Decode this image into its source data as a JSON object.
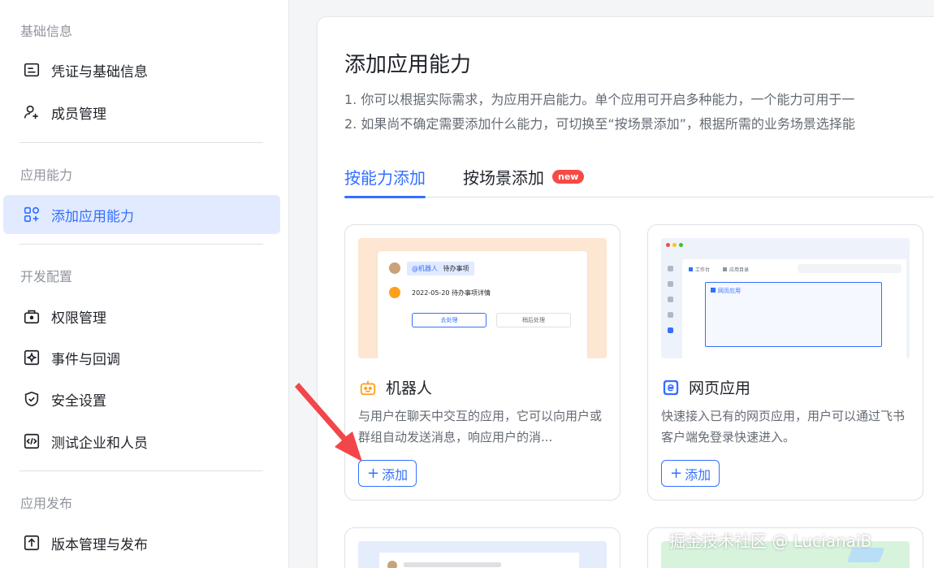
{
  "sidebar": {
    "sections": [
      {
        "title": "基础信息"
      },
      {
        "title": "应用能力"
      },
      {
        "title": "开发配置"
      },
      {
        "title": "应用发布"
      }
    ],
    "items": [
      {
        "label": "凭证与基础信息",
        "icon": "credential-icon"
      },
      {
        "label": "成员管理",
        "icon": "member-add-icon"
      },
      {
        "label": "添加应用能力",
        "icon": "grid-add-icon",
        "active": true
      },
      {
        "label": "权限管理",
        "icon": "permission-lock-icon"
      },
      {
        "label": "事件与回调",
        "icon": "event-icon"
      },
      {
        "label": "安全设置",
        "icon": "shield-check-icon"
      },
      {
        "label": "测试企业和人员",
        "icon": "test-code-icon"
      },
      {
        "label": "版本管理与发布",
        "icon": "upload-icon"
      }
    ]
  },
  "main": {
    "title": "添加应用能力",
    "desc1": "1. 你可以根据实际需求，为应用开启能力。单个应用可开启多种能力，一个能力可用于一",
    "desc2": "2. 如果尚不确定需要添加什么能力，可切换至“按场景添加”，根据所需的业务场景选择能",
    "tabs": [
      {
        "label": "按能力添加",
        "active": true
      },
      {
        "label": "按场景添加",
        "badge": "new"
      }
    ],
    "cards": [
      {
        "title": "机器人",
        "icon": "robot-icon",
        "desc": "与用户在聊天中交互的应用，它可以向用户或群组自动发送消息，响应用户的消...",
        "button": "添加",
        "preview": {
          "chip": "@机器人",
          "chip_text": "待办事项",
          "line": "2022-05-20 待办事项详情",
          "btn1": "去处理",
          "btn2": "稍后处理"
        }
      },
      {
        "title": "网页应用",
        "icon": "web-e-icon",
        "desc": "快速接入已有的网页应用，用户可以通过飞书客户端免登录快速进入。",
        "button": "添加",
        "preview": {
          "tab1": "工作台",
          "tab2": "应用目录",
          "box_label": "网页应用"
        }
      }
    ]
  },
  "watermark": "掘金技术社区 @ LucianaiB",
  "colors": {
    "accent": "#3370ff",
    "active_bg": "#e1eaff",
    "badge": "#f54a45",
    "arrow": "#f2464a"
  }
}
